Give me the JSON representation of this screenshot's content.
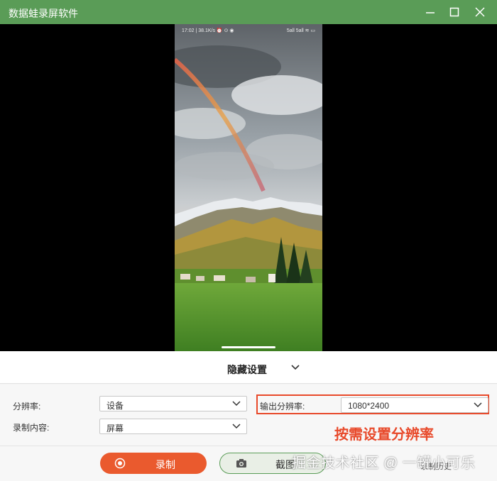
{
  "window": {
    "title": "数据蛙录屏软件"
  },
  "phone": {
    "status_time": "17:02 | 38.1K/s ⏰ ⊙ ◉",
    "status_right": "5all 5all ≋ ▭"
  },
  "settings": {
    "hide_label": "隐藏设置",
    "resolution_label": "分辨率:",
    "resolution_value": "设备",
    "content_label": "录制内容:",
    "content_value": "屏幕",
    "output_label": "输出分辨率:",
    "output_value": "1080*2400",
    "annotation": "按需设置分辨率"
  },
  "actions": {
    "record_label": "录制",
    "screenshot_label": "截图",
    "history_label": "录制历史"
  },
  "watermark": "掘金技术社区 @ 一罐小可乐",
  "colors": {
    "titlebar": "#5a9c57",
    "accent": "#ea5a2e",
    "highlight": "#e8492a"
  }
}
